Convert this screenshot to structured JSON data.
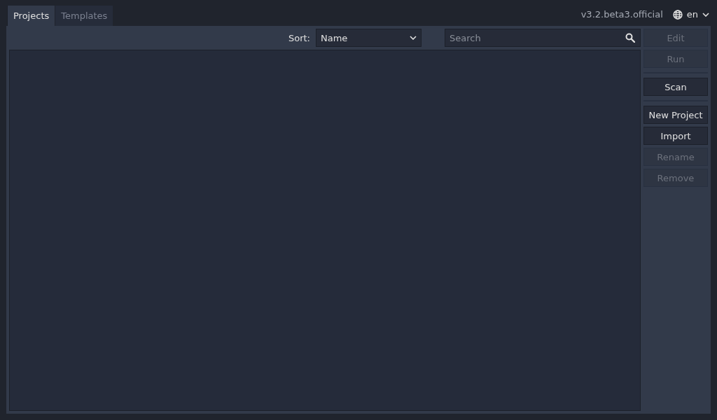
{
  "tabs": [
    {
      "label": "Projects",
      "selected": true
    },
    {
      "label": "Templates",
      "selected": false
    }
  ],
  "version": "v3.2.beta3.official",
  "language": {
    "value": "en"
  },
  "toolbar": {
    "sort_label": "Sort:",
    "sort_value": "Name",
    "search": {
      "placeholder": "Search"
    }
  },
  "button_groups": [
    [
      {
        "label": "Edit",
        "disabled": true
      },
      {
        "label": "Run",
        "disabled": true
      }
    ],
    [
      {
        "label": "Scan",
        "disabled": false
      }
    ],
    [
      {
        "label": "New Project",
        "disabled": false
      },
      {
        "label": "Import",
        "disabled": false
      },
      {
        "label": "Rename",
        "disabled": true
      },
      {
        "label": "Remove",
        "disabled": true
      }
    ]
  ]
}
